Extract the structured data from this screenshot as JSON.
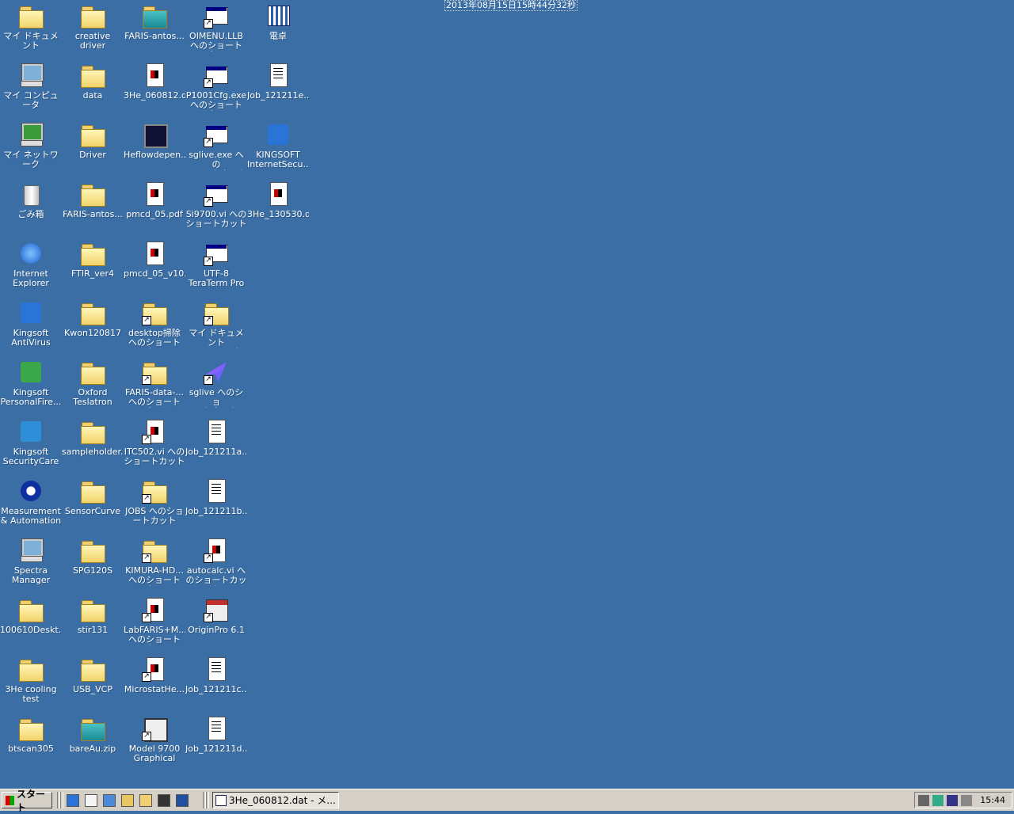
{
  "overlay_datetime": "2013年08月15日15時44分32秒",
  "desktop_icons": [
    {
      "label": "マイ ドキュメント",
      "type": "mydocs"
    },
    {
      "label": "マイ コンピュータ",
      "type": "mycomp"
    },
    {
      "label": "マイ ネットワーク",
      "type": "network"
    },
    {
      "label": "ごみ箱",
      "type": "trash"
    },
    {
      "label": "Internet\nExplorer",
      "type": "ie"
    },
    {
      "label": "Kingsoft\nAntiVirus",
      "type": "kingsoft"
    },
    {
      "label": "Kingsoft\nPersonalFire...",
      "type": "kingsoft-green"
    },
    {
      "label": "Kingsoft\nSecurityCare",
      "type": "kingsoft-care"
    },
    {
      "label": "Measurement\n& Automation",
      "type": "ni"
    },
    {
      "label": "Spectra\nManager",
      "type": "spectra"
    },
    {
      "label": "100610Deskt...",
      "type": "folder"
    },
    {
      "label": "3He cooling\ntest",
      "type": "folder"
    },
    {
      "label": "btscan305",
      "type": "folder"
    },
    {
      "label": "creative driver",
      "type": "folder"
    },
    {
      "label": "data",
      "type": "folder"
    },
    {
      "label": "Driver",
      "type": "folder"
    },
    {
      "label": "FARIS-antos...",
      "type": "folder"
    },
    {
      "label": "FTIR_ver4",
      "type": "folder"
    },
    {
      "label": "Kwon120817",
      "type": "folder"
    },
    {
      "label": "Oxford\nTeslatron",
      "type": "folder"
    },
    {
      "label": "sampleholder...",
      "type": "folder"
    },
    {
      "label": "SensorCurve",
      "type": "folder"
    },
    {
      "label": "SPG120S",
      "type": "folder"
    },
    {
      "label": "stir131",
      "type": "folder"
    },
    {
      "label": "USB_VCP",
      "type": "folder"
    },
    {
      "label": "bareAu.zip",
      "type": "zip"
    },
    {
      "label": "FARIS-antos...",
      "type": "zip"
    },
    {
      "label": "3He_060812.d...",
      "type": "file-red"
    },
    {
      "label": "Heflowdepen...",
      "type": "chart"
    },
    {
      "label": "pmcd_05.pdf",
      "type": "file-red"
    },
    {
      "label": "pmcd_05_v10...",
      "type": "file-red"
    },
    {
      "label": "desktop掃除\nへのショートカ...",
      "type": "folder-shortcut"
    },
    {
      "label": "FARIS-data-...\nへのショートカ...",
      "type": "folder-shortcut"
    },
    {
      "label": "ITC502.vi への\nショートカット",
      "type": "file-red-shortcut"
    },
    {
      "label": "JOBS へのショ\nートカット",
      "type": "folder-shortcut"
    },
    {
      "label": "KIMURA-HD...\nへのショートカ...",
      "type": "folder-shortcut"
    },
    {
      "label": "LabFARIS+M...\nへのショートカ...",
      "type": "file-red-shortcut"
    },
    {
      "label": "MicrostatHe...",
      "type": "file-red-shortcut"
    },
    {
      "label": "Model 9700\nGraphical Us...",
      "type": "labview"
    },
    {
      "label": "OIMENU.LLB\nへのショートカ...",
      "type": "app-shortcut"
    },
    {
      "label": "P1001Cfg.exe\nへのショートカ...",
      "type": "app-shortcut"
    },
    {
      "label": "sglive.exe への\nショートカット",
      "type": "app-shortcut"
    },
    {
      "label": "Si9700.vi への\nショートカット",
      "type": "app-shortcut"
    },
    {
      "label": "UTF-8\nTeraTerm Pro",
      "type": "app-shortcut"
    },
    {
      "label": "マイ ドキュメント\nへのショートカ...",
      "type": "folder-shortcut"
    },
    {
      "label": "sglive へのショ\nートカット",
      "type": "plane"
    },
    {
      "label": "Job_121211a...",
      "type": "text"
    },
    {
      "label": "Job_121211b...",
      "type": "text"
    },
    {
      "label": "autocalc.vi へ\nのショートカット",
      "type": "file-red-shortcut"
    },
    {
      "label": "OriginPro 6.1",
      "type": "origin"
    },
    {
      "label": "Job_121211c...",
      "type": "text"
    },
    {
      "label": "Job_121211d...",
      "type": "text"
    },
    {
      "label": "電卓",
      "type": "calc"
    },
    {
      "label": "Job_121211e...",
      "type": "text"
    },
    {
      "label": "KINGSOFT\nInternetSecu...",
      "type": "kingsoft-net"
    },
    {
      "label": "3He_130530.d...",
      "type": "file-red"
    }
  ],
  "taskbar": {
    "start_label": "スタート",
    "quick_launch": [
      "ie-icon",
      "notepad-icon",
      "network-icon",
      "explorer-icon",
      "folder-icon",
      "labview-icon",
      "teraterm-icon"
    ],
    "task_title": "3He_060812.dat - メ...",
    "tray_icons": [
      "volume-icon",
      "network-tray-icon",
      "monitor-tray-icon",
      "usb-tray-icon"
    ],
    "time": "15:44"
  },
  "colors": {
    "desktop": "#3a6ea5",
    "taskbar": "#d4d0c8"
  }
}
